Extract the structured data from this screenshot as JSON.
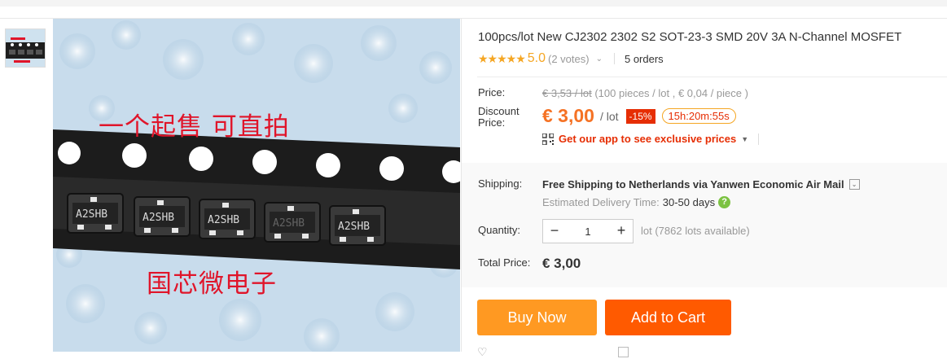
{
  "product": {
    "title": "100pcs/lot New CJ2302 2302 S2 SOT-23-3 SMD 20V 3A N-Channel MOSFET",
    "image_text_top": "一个起售  可直拍",
    "image_text_bottom": "国芯微电子",
    "chip_marking": "A2SHB"
  },
  "rating": {
    "stars": "★★★★★",
    "value": "5.0",
    "votes": "(2 votes)",
    "orders": "5 orders"
  },
  "pricing": {
    "price_label": "Price:",
    "old_price": "€ 3,53 / lot",
    "old_price_detail": "(100 pieces / lot , € 0,04 / piece )",
    "discount_label": "Discount Price:",
    "discount_price": "€ 3,00",
    "unit": "/ lot",
    "discount_badge": "-15%",
    "timer": "15h:20m:55s",
    "app_promo": "Get our app to see exclusive prices"
  },
  "shipping": {
    "label": "Shipping:",
    "value": "Free Shipping to Netherlands via Yanwen Economic Air Mail",
    "delivery_label": "Estimated Delivery Time:",
    "delivery_days": "30-50 days"
  },
  "quantity": {
    "label": "Quantity:",
    "value": "1",
    "available": "lot (7862 lots available)"
  },
  "total": {
    "label": "Total Price:",
    "value": "€ 3,00"
  },
  "actions": {
    "buy_now": "Buy Now",
    "add_to_cart": "Add to Cart"
  },
  "colors": {
    "accent_orange": "#f57224",
    "buy_button": "#ff9922",
    "cart_button": "#ff5a00",
    "badge_red": "#e62e04",
    "star_yellow": "#f5a623"
  }
}
